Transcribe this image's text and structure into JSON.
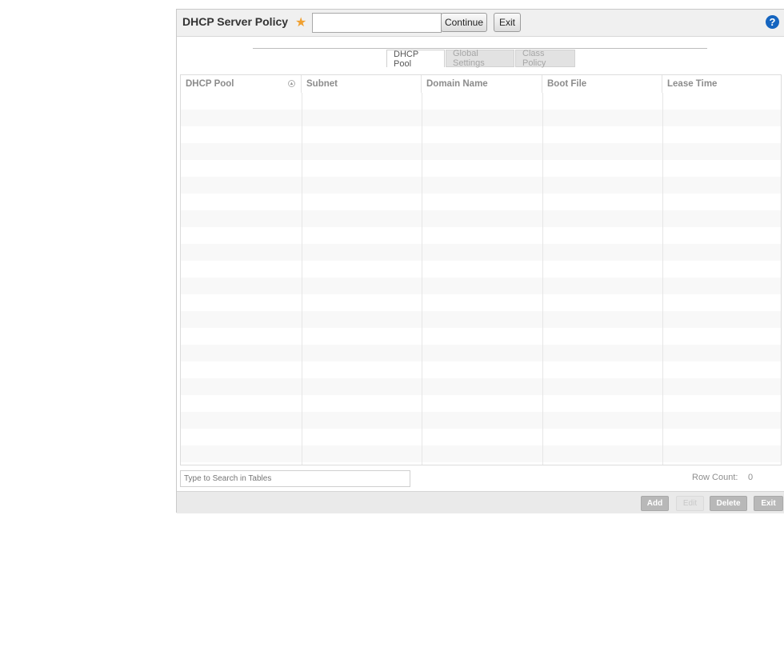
{
  "header": {
    "title": "DHCP Server Policy",
    "name_value": "",
    "continue_label": "Continue",
    "exit_label": "Exit",
    "help_glyph": "?"
  },
  "tabs": [
    {
      "label": "DHCP Pool",
      "active": true
    },
    {
      "label": "Global Settings",
      "active": false
    },
    {
      "label": "Class Policy",
      "active": false
    }
  ],
  "table": {
    "columns": [
      "DHCP Pool",
      "Subnet",
      "Domain Name",
      "Boot File",
      "Lease Time"
    ],
    "rows": []
  },
  "search": {
    "placeholder": "Type to Search in Tables"
  },
  "row_count": {
    "label": "Row Count:",
    "value": "0"
  },
  "footer": {
    "add_label": "Add",
    "edit_label": "Edit",
    "delete_label": "Delete",
    "exit_label": "Exit"
  },
  "colors": {
    "accent_star": "#f0a030",
    "help_blue": "#1565c0"
  }
}
